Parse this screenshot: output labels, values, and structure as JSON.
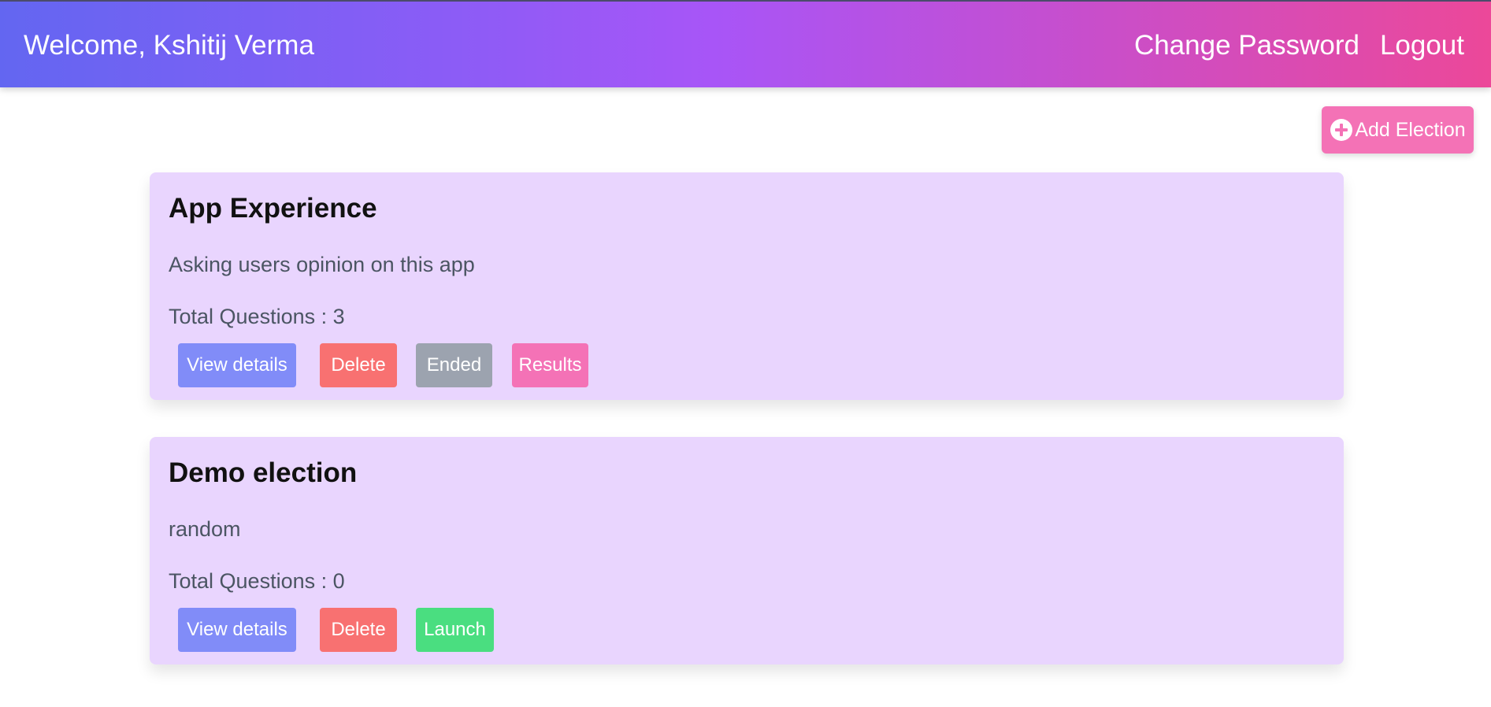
{
  "header": {
    "welcome": "Welcome, Kshitij Verma",
    "links": [
      "Change Password",
      "Logout"
    ]
  },
  "actions": {
    "add_election": "Add Election",
    "add_icon": "plus-circle-icon"
  },
  "elections": [
    {
      "title": "App Experience",
      "description": "Asking users opinion on this app",
      "questions_label": "Total Questions",
      "questions_count": "3",
      "buttons": {
        "view": "View details",
        "delete": "Delete",
        "status": "Ended",
        "results": "Results"
      }
    },
    {
      "title": "Demo election",
      "description": "random",
      "questions_label": "Total Questions",
      "questions_count": "0",
      "buttons": {
        "view": "View details",
        "delete": "Delete",
        "launch": "Launch"
      }
    }
  ],
  "colors": {
    "view": "#818cf8",
    "delete": "#f87171",
    "ended": "#9ca3af",
    "results": "#f472b6",
    "launch": "#4ade80",
    "card_bg": "#e9d5fe"
  }
}
